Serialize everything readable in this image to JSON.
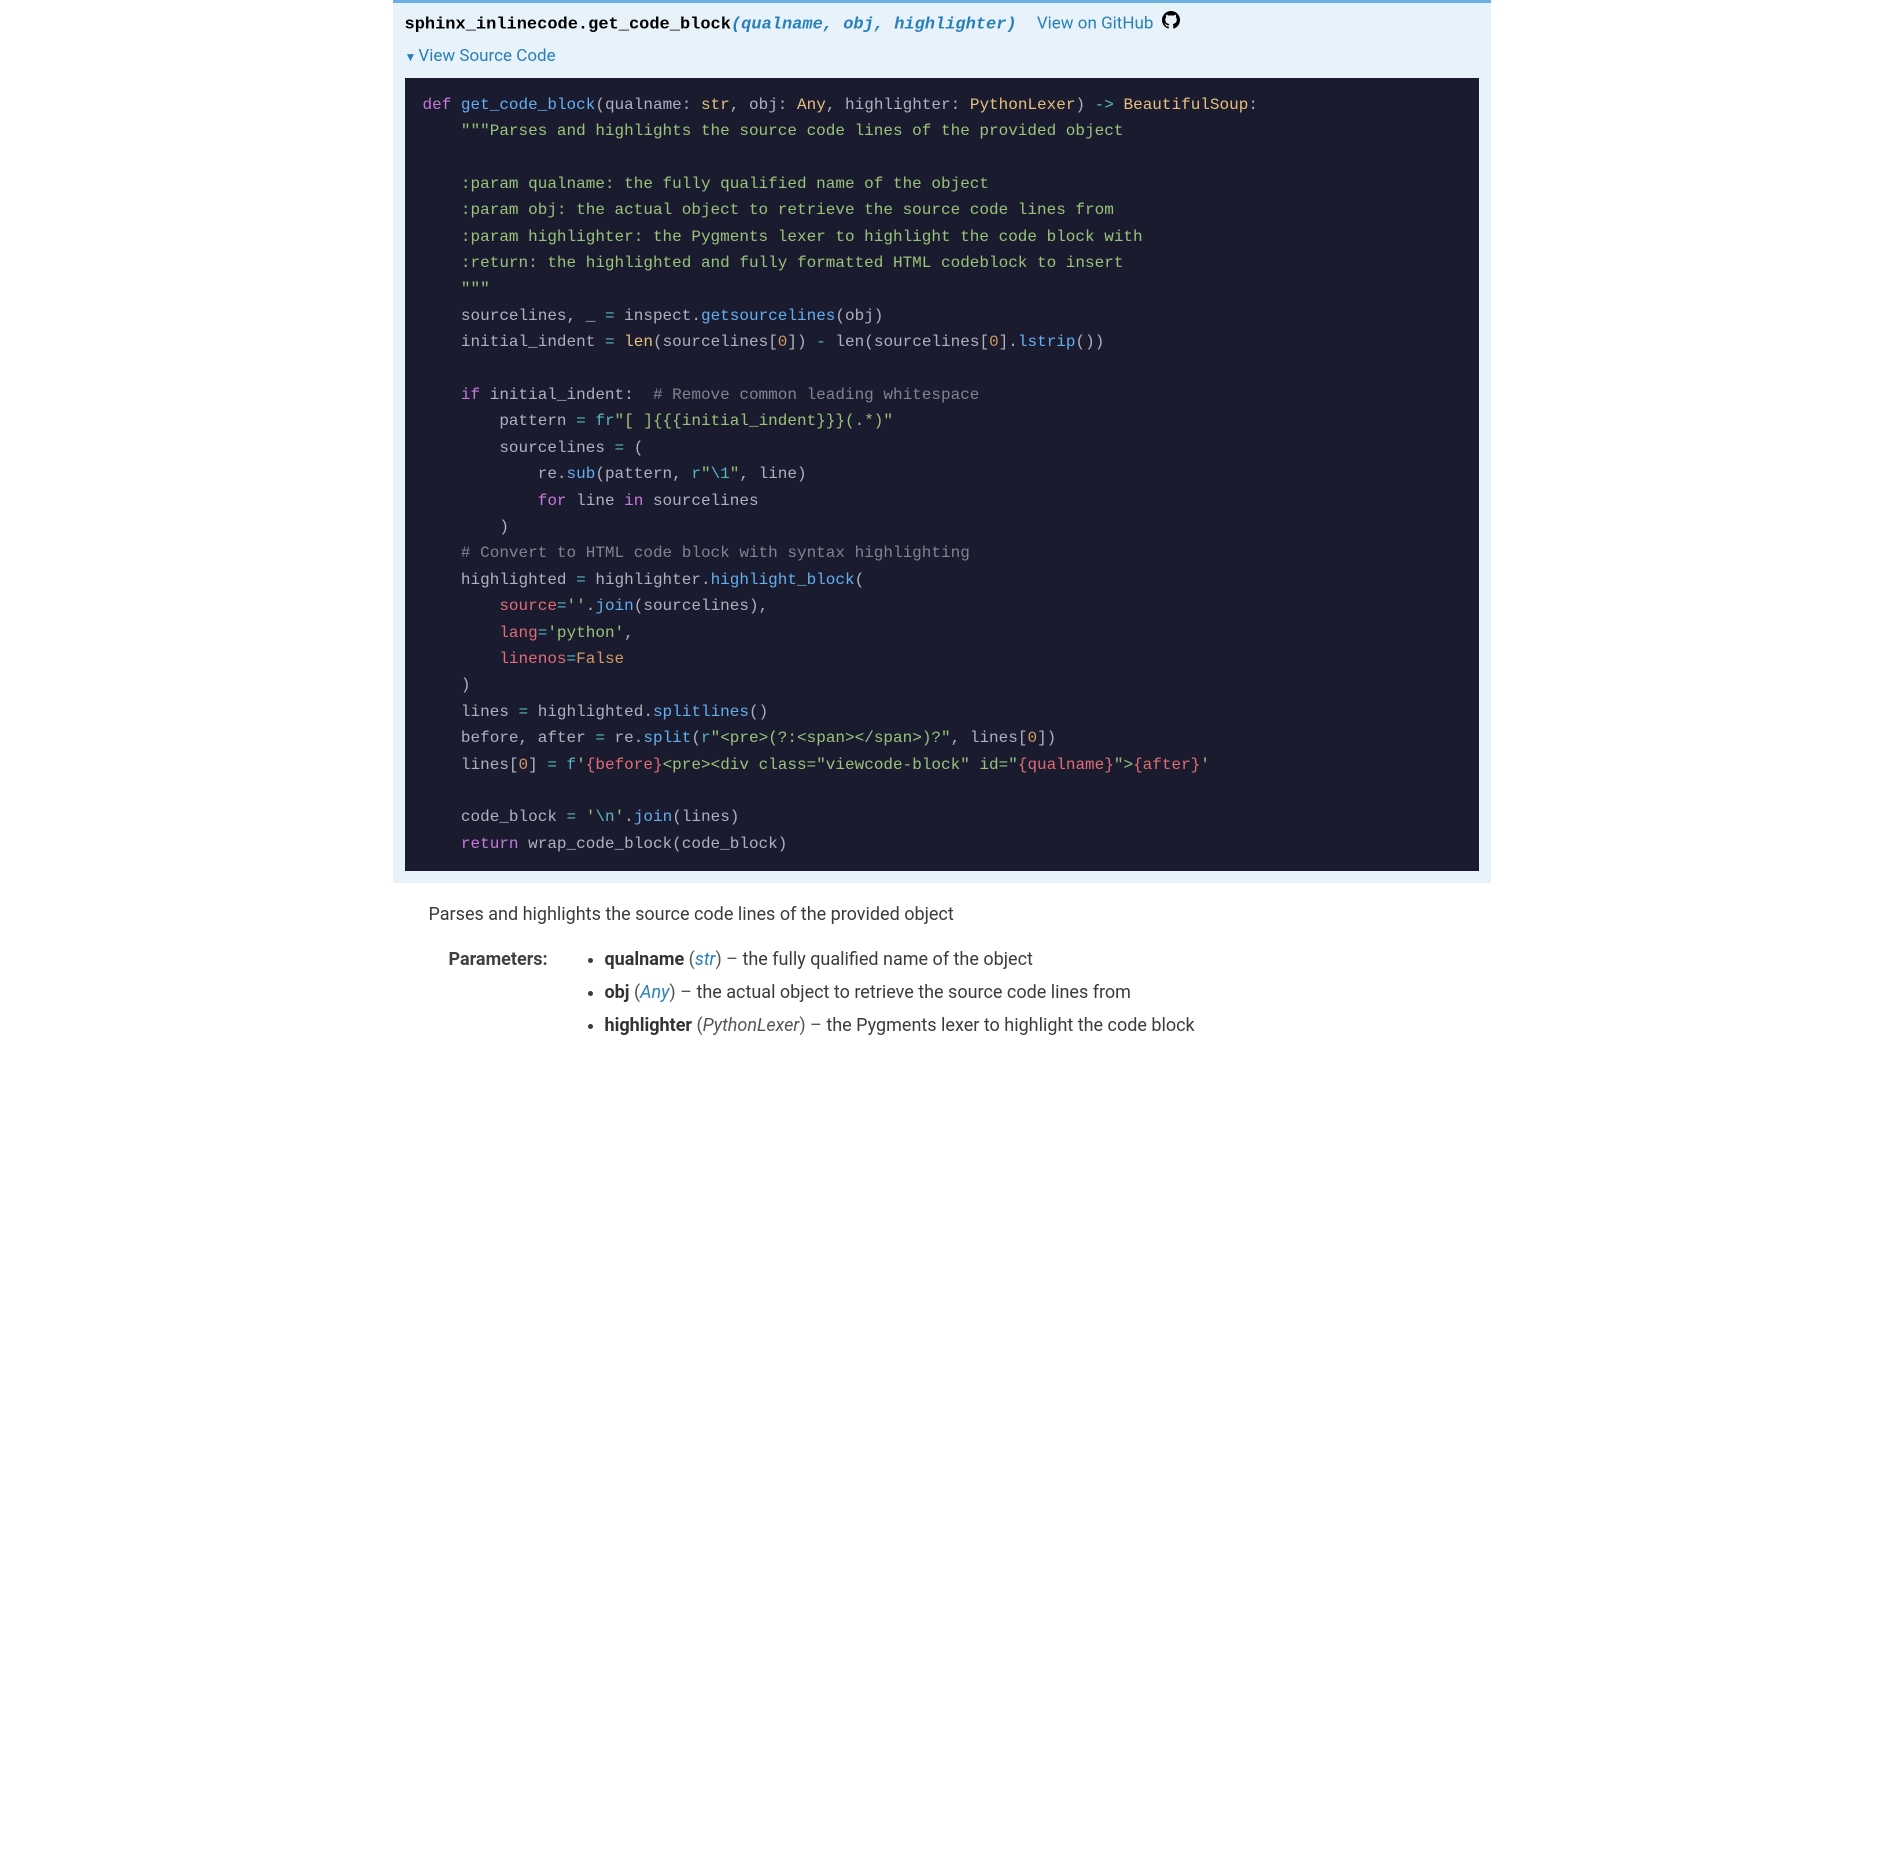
{
  "signature": {
    "module": "sphinx_inlinecode.",
    "funcname": "get_code_block",
    "open_paren": "(",
    "params": "qualname, obj, highlighter",
    "close_paren": ")",
    "github_label": "View on GitHub"
  },
  "toggle": {
    "label": "View Source Code"
  },
  "code": {
    "kw_def": "def",
    "fn_name": "get_code_block",
    "p1": "qualname",
    "t1": "str",
    "p2": "obj",
    "t2": "Any",
    "p3": "highlighter",
    "t3": "PythonLexer",
    "arrow": "->",
    "ret": "BeautifulSoup",
    "doc_open": "\"\"\"Parses and highlights the source code lines of the provided object",
    "doc_l1": ":param qualname: the fully qualified name of the object",
    "doc_l2": ":param obj: the actual object to retrieve the source code lines from",
    "doc_l3": ":param highlighter: the Pygments lexer to highlight the code block with",
    "doc_l4": ":return: the highlighted and fully formatted HTML codeblock to insert",
    "doc_close": "\"\"\"",
    "line_src": "sourcelines, _ ",
    "eq": "=",
    "inspect": " inspect",
    "getsourcelines": "getsourcelines",
    "obj_arg": "(obj)",
    "line_ind1": "initial_indent ",
    "len1": "len",
    "len1_arg": "(sourcelines[",
    "zero": "0",
    "close_br": "]) ",
    "minus": "-",
    "len2": " len",
    "len2_arg": "(sourcelines[",
    "lstrip": "lstrip",
    "lstrip_call": "())",
    "kw_if": "if",
    "if_cond": " initial_indent:",
    "cmt1": "  # Remove common leading whitespace",
    "pat_lhs": "pattern ",
    "fr": "fr",
    "pat_str": "\"[ ]{{{initial_indent}}}(.*)\"",
    "srcl_lhs": "sourcelines ",
    "open_p": " (",
    "re_mod": "re",
    "sub": "sub",
    "sub_open": "(pattern, ",
    "r_prefix": "r",
    "r_str": "\"",
    "esc1": "\\1",
    "r_str_close": "\"",
    "sub_close": ", line)",
    "kw_for": "for",
    "for_body": " line ",
    "kw_in": "in",
    "in_body": " sourcelines",
    "close_p": ")",
    "cmt2": "# Convert to HTML code block with syntax highlighting",
    "hl_lhs": "highlighted ",
    "highlighter_id": " highlighter",
    "hl_block": "highlight_block",
    "hl_open": "(",
    "src_kw": "source",
    "src_eq": "=",
    "empty": "''",
    "join1": "join",
    "join1_arg": "(sourcelines),",
    "lang_kw": "lang",
    "lang_val": "'python'",
    "comma": ",",
    "linenos_kw": "linenos",
    "false": "False",
    "lines_lhs": "lines ",
    "splitlines": "splitlines",
    "splitlines_call": "()",
    "ba_lhs": "before, after ",
    "re2": " re",
    "split": "split",
    "split_open": "(",
    "split_str": "\"<pre>(?:<span></span>)?\"",
    "split_rest": ", lines[",
    "split_close": "])",
    "l0_lhs": "lines[",
    "l0_close": "] ",
    "f_prefix": "f",
    "f_open": "'",
    "f_i1": "{before}",
    "f_mid": "<pre><div class=\"viewcode-block\" id=\"",
    "f_i2": "{qualname}",
    "f_mid2": "\">",
    "f_i3": "{after}",
    "f_close": "'",
    "cb_lhs": "code_block ",
    "nl_open": "'",
    "nl_esc": "\\n",
    "nl_close": "'",
    "join2": "join",
    "join2_arg": "(lines)",
    "kw_return": "return",
    "wrap": " wrap_code_block(code_block)",
    "dot": ".",
    "highlighted_id": " highlighted"
  },
  "doc": {
    "summary": "Parses and highlights the source code lines of the provided object",
    "params_label": "Parameters:",
    "items": [
      {
        "name": "qualname",
        "type": "str",
        "type_link": true,
        "desc": "the fully qualified name of the object"
      },
      {
        "name": "obj",
        "type": "Any",
        "type_link": true,
        "desc": "the actual object to retrieve the source code lines from"
      },
      {
        "name": "highlighter",
        "type": "PythonLexer",
        "type_link": false,
        "desc": "the Pygments lexer to highlight the code block"
      }
    ]
  }
}
